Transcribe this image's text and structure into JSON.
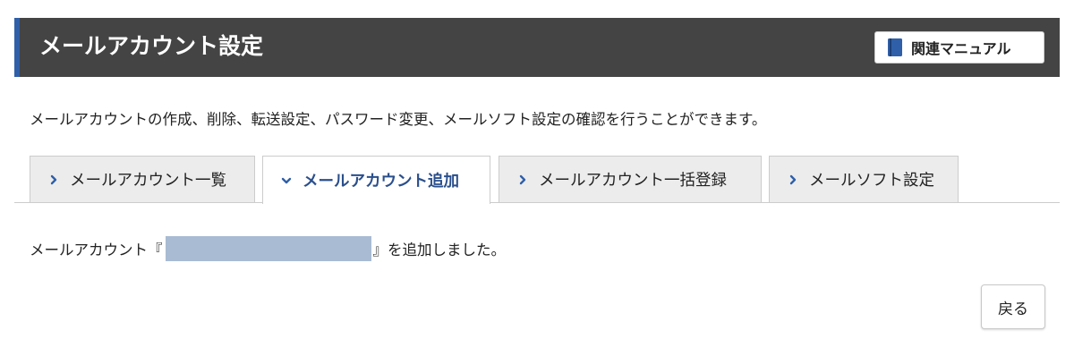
{
  "header": {
    "title": "メールアカウント設定",
    "manual_button_label": "関連マニュアル",
    "manual_icon": "book-icon"
  },
  "description": "メールアカウントの作成、削除、転送設定、パスワード変更、メールソフト設定の確認を行うことができます。",
  "tabs": [
    {
      "label": "メールアカウント一覧",
      "active": false,
      "icon": "chevron-right-icon"
    },
    {
      "label": "メールアカウント追加",
      "active": true,
      "icon": "chevron-down-icon"
    },
    {
      "label": "メールアカウント一括登録",
      "active": false,
      "icon": "chevron-right-icon"
    },
    {
      "label": "メールソフト設定",
      "active": false,
      "icon": "chevron-right-icon"
    }
  ],
  "result": {
    "prefix": "メールアカウント『",
    "suffix": "』を追加しました。"
  },
  "back_button_label": "戻る",
  "colors": {
    "header_bg": "#444444",
    "header_accent": "#2f5fa8",
    "active_tab_text": "#2a4f8c",
    "masked_fill": "#a9bbd3"
  }
}
